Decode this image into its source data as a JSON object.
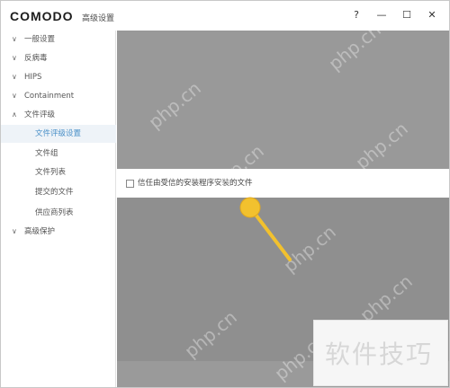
{
  "app": {
    "logo_text": "COMODO",
    "window_title": "高级设置"
  },
  "window_buttons": {
    "help": "?",
    "minimize": "—",
    "maximize": "☐",
    "close": "✕"
  },
  "sidebar": {
    "items": [
      {
        "label": "一般设置",
        "chevron": "∨",
        "level": 0
      },
      {
        "label": "反病毒",
        "chevron": "∨",
        "level": 0
      },
      {
        "label": "HIPS",
        "chevron": "∨",
        "level": 0
      },
      {
        "label": "Containment",
        "chevron": "∨",
        "level": 0
      },
      {
        "label": "文件评级",
        "chevron": "∧",
        "level": 0
      },
      {
        "label": "文件评级设置",
        "level": 1,
        "active": true
      },
      {
        "label": "文件组",
        "level": 1
      },
      {
        "label": "文件列表",
        "level": 1
      },
      {
        "label": "提交的文件",
        "level": 1
      },
      {
        "label": "供应商列表",
        "level": 1
      },
      {
        "label": "高级保护",
        "chevron": "∨",
        "level": 0
      }
    ]
  },
  "main": {
    "option_label": "信任由受信的安装程序安装的文件",
    "option_checked": false
  },
  "watermarks": [
    "php.cn",
    "php.cn",
    "php.cn",
    "php.cn",
    "php.cn",
    "php.cn",
    "php.cn",
    "php.cn"
  ],
  "stamp_text": "软件技巧",
  "colors": {
    "accent": "#4a90c8",
    "indicator": "#f2c12e"
  }
}
